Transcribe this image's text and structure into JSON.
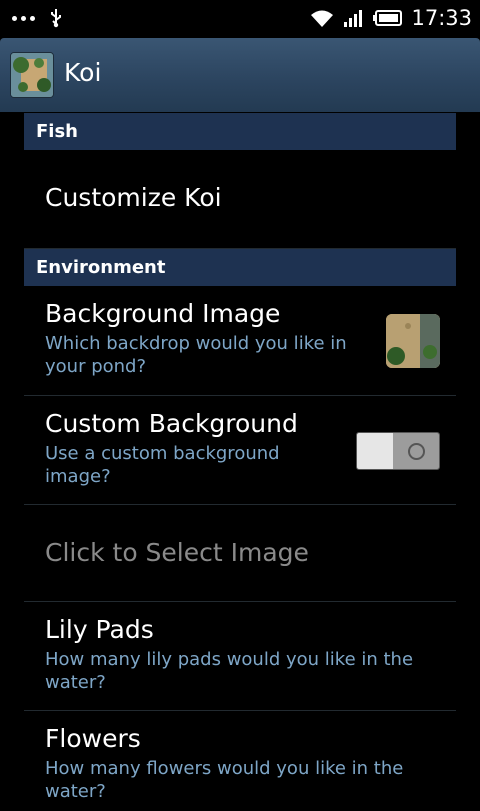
{
  "status_bar": {
    "time": "17:33",
    "icons": [
      "more-notifications-icon",
      "usb-icon",
      "wifi-icon",
      "signal-icon",
      "battery-icon"
    ]
  },
  "action_bar": {
    "title": "Koi",
    "icon": "koi-pond-app-icon"
  },
  "sections": [
    {
      "header": "Fish"
    },
    {
      "header": "Environment"
    }
  ],
  "items": {
    "customize_koi": {
      "title": "Customize Koi"
    },
    "background_image": {
      "title": "Background Image",
      "summary": "Which backdrop would you like in your pond?"
    },
    "custom_background": {
      "title": "Custom Background",
      "summary": "Use a custom background image?",
      "toggle_state": "off"
    },
    "select_image": {
      "title": "Click to Select Image",
      "enabled": false
    },
    "lily_pads": {
      "title": "Lily Pads",
      "summary": "How many lily pads would you like in the water?"
    },
    "flowers": {
      "title": "Flowers",
      "summary": "How many flowers would you like in the water?"
    }
  },
  "colors": {
    "action_bar": "#2c4560",
    "category_header": "#1e3251",
    "summary_text": "#7ea6c7",
    "disabled_text": "#8a8a8a"
  }
}
